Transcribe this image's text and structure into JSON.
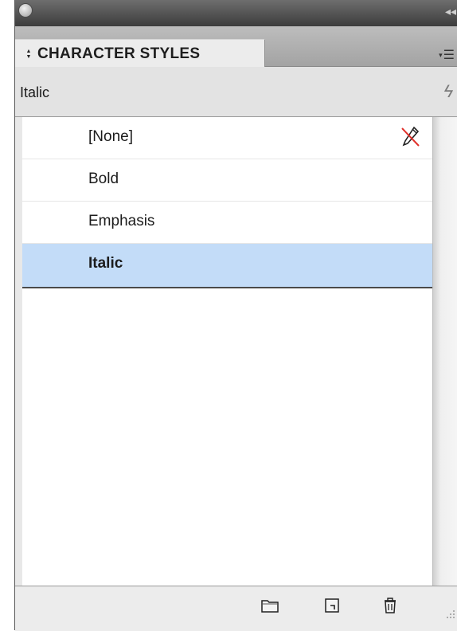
{
  "panel": {
    "tab_label": "CHARACTER STYLES",
    "current_style": "Italic"
  },
  "styles": [
    {
      "label": "[None]",
      "selected": false,
      "locked": true
    },
    {
      "label": "Bold",
      "selected": false
    },
    {
      "label": "Emphasis",
      "selected": false
    },
    {
      "label": "Italic",
      "selected": true
    }
  ],
  "icons": {
    "close": "close-icon",
    "collapse": "collapse-arrows-icon",
    "panel_menu": "panel-menu-icon",
    "quick_apply": "lightning-icon",
    "locked": "pencil-strikethrough-icon",
    "new_group": "folder-icon",
    "new_style": "new-page-icon",
    "delete": "trash-icon",
    "resize": "resize-grip-icon"
  },
  "colors": {
    "selection": "#c3dcf8",
    "titlebar": "#4a4a4a",
    "locked_mark": "#e0302a"
  }
}
